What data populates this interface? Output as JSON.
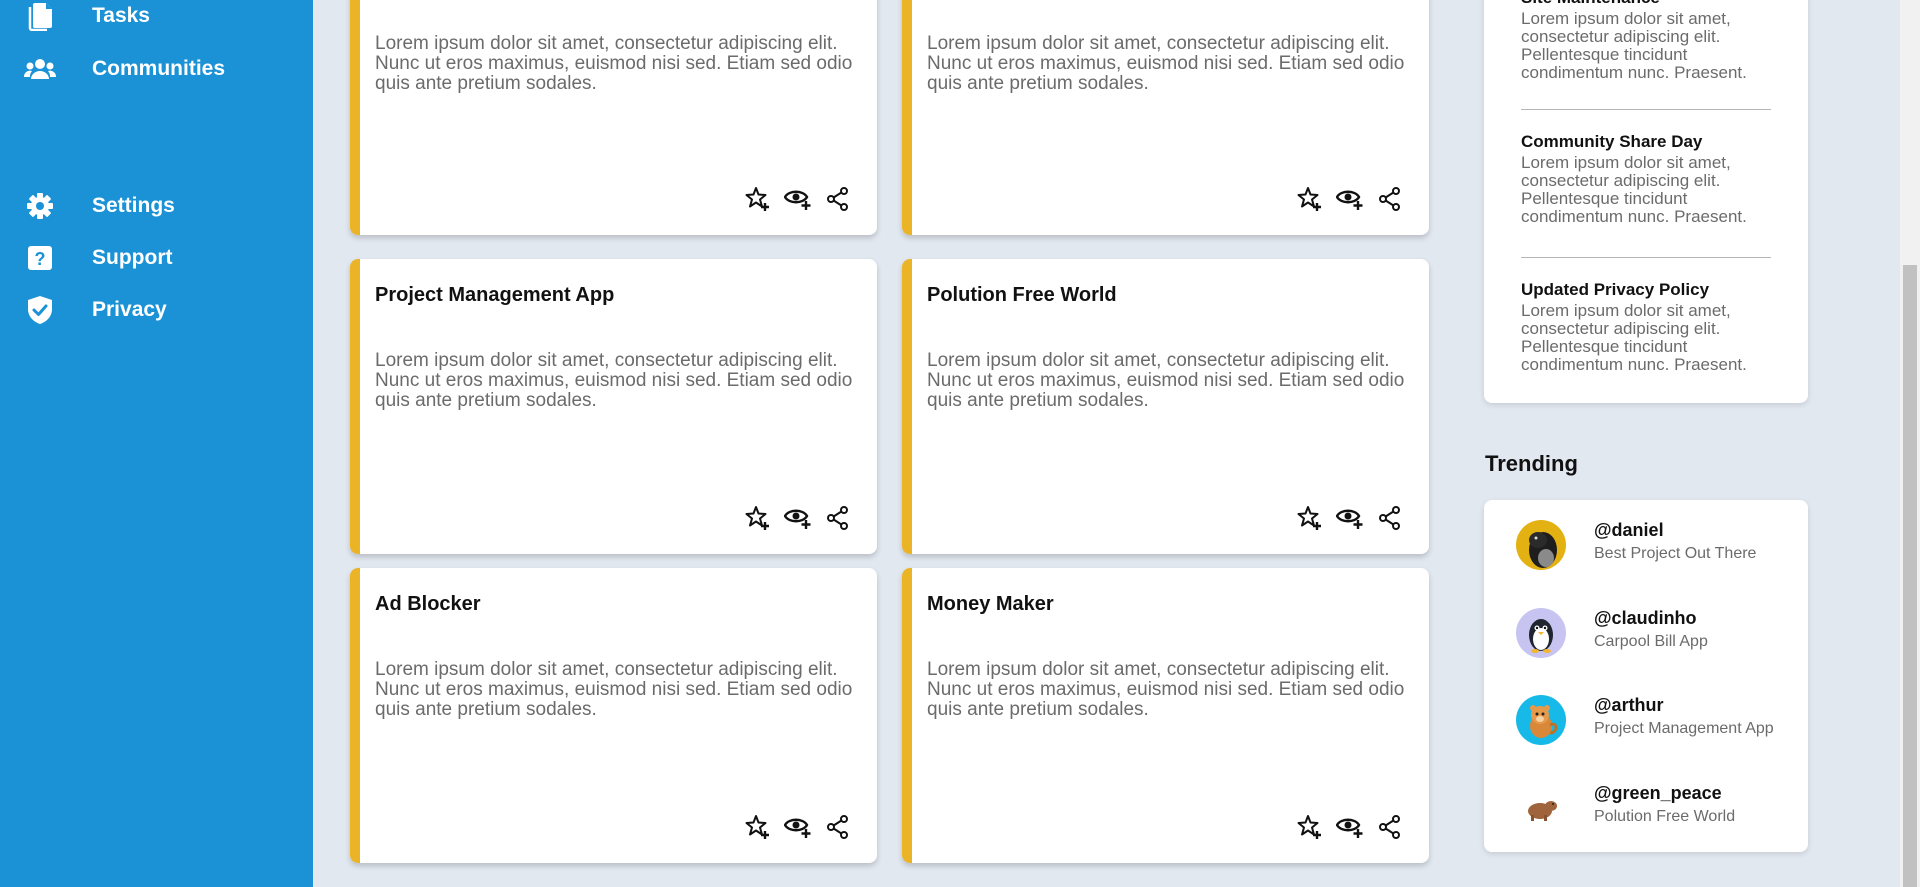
{
  "sidebar": {
    "items": [
      {
        "label": "Tasks",
        "icon": "file-icon"
      },
      {
        "label": "Communities",
        "icon": "users-icon"
      },
      {
        "label": "Settings",
        "icon": "gear-icon"
      },
      {
        "label": "Support",
        "icon": "question-icon"
      },
      {
        "label": "Privacy",
        "icon": "shield-icon"
      }
    ]
  },
  "projects": [
    {
      "title": "",
      "desc": "Lorem ipsum dolor sit amet, consectetur adipiscing elit. Nunc ut eros maximus, euismod nisi sed. Etiam sed odio quis ante pretium sodales."
    },
    {
      "title": "",
      "desc": "Lorem ipsum dolor sit amet, consectetur adipiscing elit. Nunc ut eros maximus, euismod nisi sed. Etiam sed odio quis ante pretium sodales."
    },
    {
      "title": "Project Management App",
      "desc": "Lorem ipsum dolor sit amet, consectetur adipiscing elit. Nunc ut eros maximus, euismod nisi sed. Etiam sed odio quis ante pretium sodales."
    },
    {
      "title": "Polution Free World",
      "desc": "Lorem ipsum dolor sit amet, consectetur adipiscing elit. Nunc ut eros maximus, euismod nisi sed. Etiam sed odio quis ante pretium sodales."
    },
    {
      "title": "Ad Blocker",
      "desc": "Lorem ipsum dolor sit amet, consectetur adipiscing elit. Nunc ut eros maximus, euismod nisi sed. Etiam sed odio quis ante pretium sodales."
    },
    {
      "title": "Money Maker",
      "desc": "Lorem ipsum dolor sit amet, consectetur adipiscing elit. Nunc ut eros maximus, euismod nisi sed. Etiam sed odio quis ante pretium sodales."
    }
  ],
  "announcements": [
    {
      "title": "Site Maintenance",
      "text": "Lorem ipsum dolor sit amet, consectetur adipiscing elit. Pellentesque tincidunt condimentum nunc. Praesent."
    },
    {
      "title": "Community Share Day",
      "text": "Lorem ipsum dolor sit amet, consectetur adipiscing elit. Pellentesque tincidunt condimentum nunc. Praesent."
    },
    {
      "title": "Updated Privacy Policy",
      "text": "Lorem ipsum dolor sit amet, consectetur adipiscing elit. Pellentesque tincidunt condimentum nunc. Praesent."
    }
  ],
  "trending": {
    "heading": "Trending",
    "items": [
      {
        "handle": "@daniel",
        "project": "Best Project Out There",
        "avatar_bg": "#e4b112"
      },
      {
        "handle": "@claudinho",
        "project": "Carpool Bill App",
        "avatar_bg": "#c8c4f2"
      },
      {
        "handle": "@arthur",
        "project": "Project Management App",
        "avatar_bg": "#16b9e8"
      },
      {
        "handle": "@green_peace",
        "project": "Polution Free World",
        "avatar_bg": "#ffffff"
      }
    ]
  },
  "colors": {
    "sidebar": "#1b92d6",
    "accent": "#ebb326",
    "background": "#e2e8f0"
  }
}
